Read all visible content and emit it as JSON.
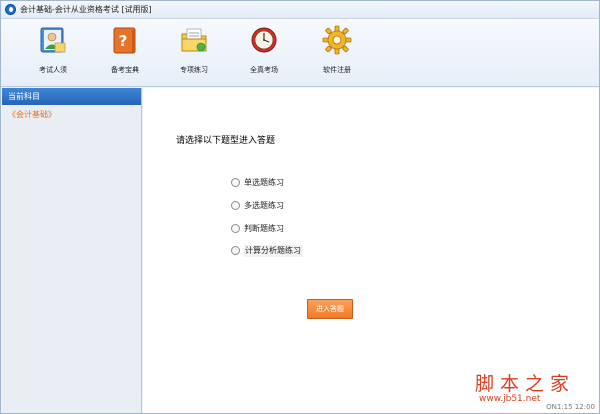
{
  "window": {
    "title": "会计基础-会计从业资格考试 [试用版]"
  },
  "toolbar": {
    "items": [
      {
        "label": "考试人须",
        "icon": "person-book-icon"
      },
      {
        "label": "备考宝典",
        "icon": "question-book-icon"
      },
      {
        "label": "专项练习",
        "icon": "folder-document-icon"
      },
      {
        "label": "全真考场",
        "icon": "clock-icon"
      },
      {
        "label": "软件注册",
        "icon": "gear-icon"
      }
    ]
  },
  "sidebar": {
    "header": "当前科目",
    "current_subject": "《会计基础》"
  },
  "main": {
    "prompt": "请选择以下题型进入答题",
    "options": [
      {
        "label": "单选题练习"
      },
      {
        "label": "多选题练习"
      },
      {
        "label": "判断题练习"
      },
      {
        "label": "计算分析题练习"
      }
    ],
    "enter_button": "进入答题"
  },
  "status": {
    "text": "ON1:15 12:00"
  },
  "watermark": {
    "text": "脚本之家",
    "url": "www.jb51.net"
  },
  "colors": {
    "sidebar_header": "#2f73c8",
    "accent_orange": "#ef7a26",
    "subject_text": "#e4721d"
  }
}
